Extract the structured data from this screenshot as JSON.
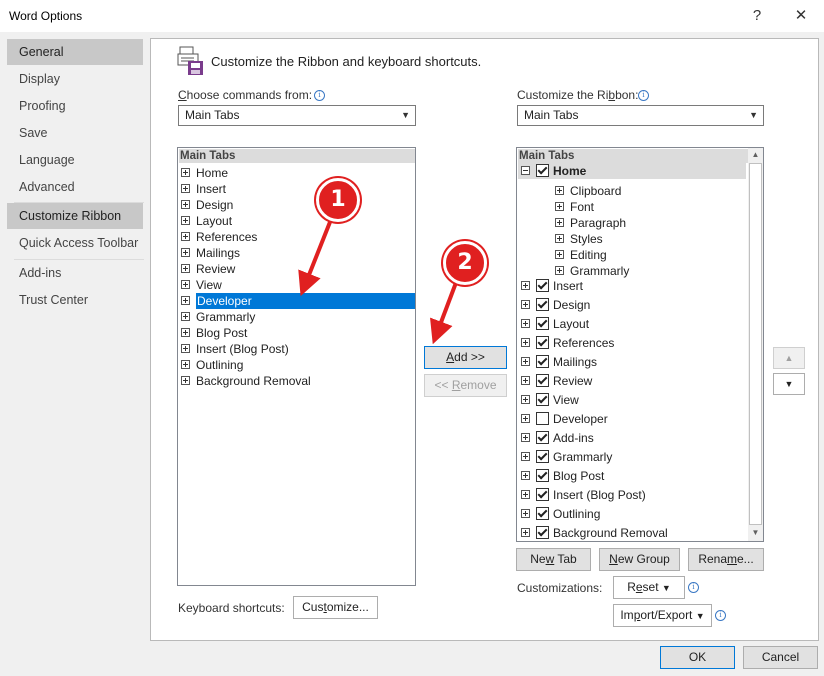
{
  "window": {
    "title": "Word Options",
    "help_label": "?",
    "close_label": "✕"
  },
  "sidebar": {
    "items": [
      {
        "label": "General"
      },
      {
        "label": "Display"
      },
      {
        "label": "Proofing"
      },
      {
        "label": "Save"
      },
      {
        "label": "Language"
      },
      {
        "label": "Advanced"
      },
      {
        "label": "Customize Ribbon"
      },
      {
        "label": "Quick Access Toolbar"
      },
      {
        "label": "Add-ins"
      },
      {
        "label": "Trust Center"
      }
    ],
    "selected": "Customize Ribbon"
  },
  "main": {
    "heading": "Customize the Ribbon and keyboard shortcuts.",
    "left": {
      "label": "Choose commands from:",
      "combo_value": "Main Tabs",
      "list_header": "Main Tabs",
      "items": [
        "Home",
        "Insert",
        "Design",
        "Layout",
        "References",
        "Mailings",
        "Review",
        "View",
        "Developer",
        "Grammarly",
        "Blog Post",
        "Insert (Blog Post)",
        "Outlining",
        "Background Removal"
      ],
      "selected_item": "Developer"
    },
    "add_button": "Add >>",
    "remove_button": "<< Remove",
    "right": {
      "label": "Customize the Ribbon:",
      "combo_value": "Main Tabs",
      "list_header": "Main Tabs",
      "home": {
        "label": "Home",
        "checked": true,
        "groups": [
          "Clipboard",
          "Font",
          "Paragraph",
          "Styles",
          "Editing",
          "Grammarly"
        ]
      },
      "tabs": [
        {
          "label": "Insert",
          "checked": true
        },
        {
          "label": "Design",
          "checked": true
        },
        {
          "label": "Layout",
          "checked": true
        },
        {
          "label": "References",
          "checked": true
        },
        {
          "label": "Mailings",
          "checked": true
        },
        {
          "label": "Review",
          "checked": true
        },
        {
          "label": "View",
          "checked": true
        },
        {
          "label": "Developer",
          "checked": false
        },
        {
          "label": "Add-ins",
          "checked": true
        },
        {
          "label": "Grammarly",
          "checked": true
        },
        {
          "label": "Blog Post",
          "checked": true
        },
        {
          "label": "Insert (Blog Post)",
          "checked": true
        },
        {
          "label": "Outlining",
          "checked": true
        },
        {
          "label": "Background Removal",
          "checked": true
        }
      ]
    },
    "new_tab_button": "New Tab",
    "new_group_button": "New Group",
    "rename_button": "Rename...",
    "customizations_label": "Customizations:",
    "reset_button": "Reset",
    "import_export_button": "Import/Export",
    "keyboard_label": "Keyboard shortcuts:",
    "customize_button": "Customize..."
  },
  "footer": {
    "ok": "OK",
    "cancel": "Cancel"
  },
  "annotations": {
    "callout_1": "1",
    "callout_2": "2",
    "color": "#e02020"
  }
}
